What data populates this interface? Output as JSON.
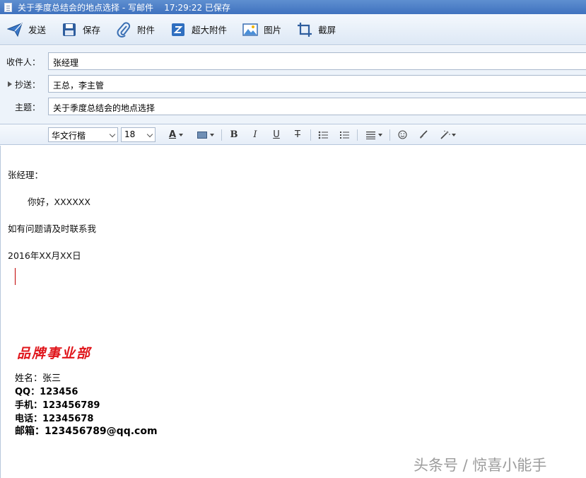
{
  "window": {
    "title": "关于季度总结会的地点选择 - 写邮件    17:29:22 已保存"
  },
  "toolbar": {
    "send": "发送",
    "save": "保存",
    "attach": "附件",
    "large_attach": "超大附件",
    "picture": "图片",
    "screenshot": "截屏"
  },
  "fields": {
    "to_label": "收件人：",
    "to_value": "张经理",
    "cc_label": "抄送：",
    "cc_value": "王总，李主管",
    "subject_label": "主题：",
    "subject_value": "关于季度总结会的地点选择"
  },
  "format": {
    "font": "华文行楷",
    "size": "18",
    "bold": "B",
    "italic": "I",
    "underline": "U",
    "strike": "T"
  },
  "body": {
    "greeting": "张经理：",
    "line1": "你好，XXXXXX",
    "line2": "如有问题请及时联系我",
    "date": "2016年XX月XX日"
  },
  "signature": {
    "brand": "品牌事业部",
    "name_label": "姓名：",
    "name_value": "张三",
    "qq_label": "QQ：",
    "qq_value": "123456",
    "mobile_label": "手机：",
    "mobile_value": "123456789",
    "phone_label": "电话：",
    "phone_value": "12345678",
    "email_label": "邮箱：",
    "email_value": "123456789@qq.com"
  },
  "watermark": "头条号 / 惊喜小能手",
  "colors": {
    "accent": "#3f72bf",
    "brand_red": "#e0161b",
    "cursor": "#c00000"
  }
}
